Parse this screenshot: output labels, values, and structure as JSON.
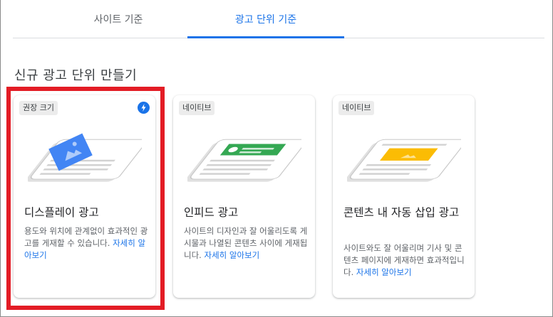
{
  "tabs": [
    {
      "label": "사이트 기준"
    },
    {
      "label": "광고 단위 기준"
    }
  ],
  "section_title": "신규 광고 단위 만들기",
  "cards": [
    {
      "chip": "권장 크기",
      "title": "디스플레이 광고",
      "desc": "용도와 위치에 관계없이 효과적인 광고를 게재할 수 있습니다.",
      "learn_more": "자세히 알아보기",
      "illustration_color": "#4285f4"
    },
    {
      "chip": "네이티브",
      "title": "인피드 광고",
      "desc": "사이트의 디자인과 잘 어울리도록 게시물과 나열된 콘텐츠 사이에 게재됩니다.",
      "learn_more": "자세히 알아보기",
      "illustration_color": "#34a853"
    },
    {
      "chip": "네이티브",
      "title": "콘텐츠 내 자동 삽입 광고",
      "desc": "사이트와도 잘 어울리며 기사 및 콘텐츠 페이지에 게재하면 효과적입니다.",
      "learn_more": "자세히 알아보기",
      "illustration_color": "#fbbc04"
    }
  ],
  "colors": {
    "accent": "#1a73e8",
    "highlight": "#e31c25"
  }
}
